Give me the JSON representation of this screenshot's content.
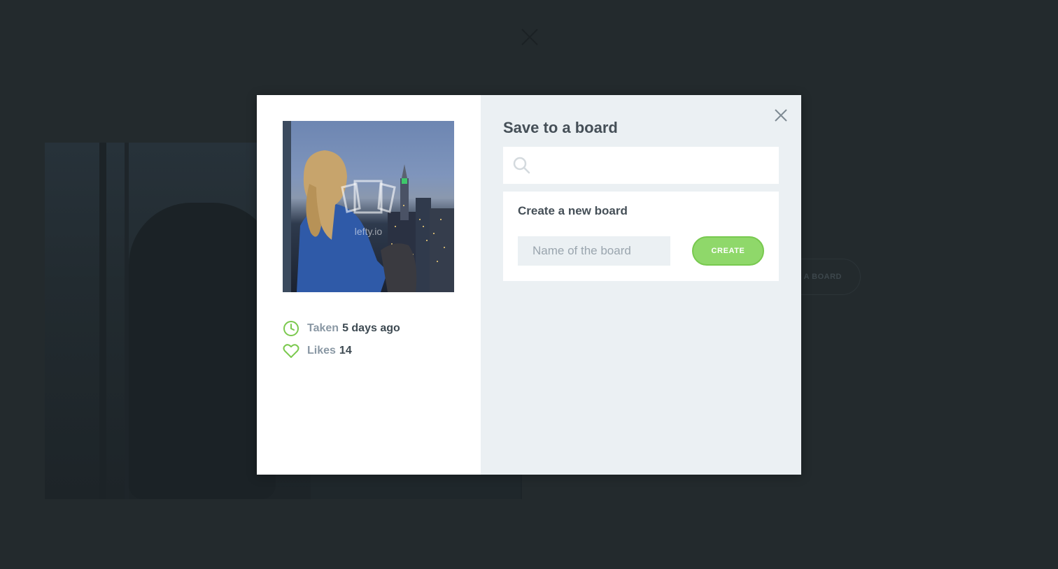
{
  "background": {
    "save_board_label": "A BOARD"
  },
  "modal": {
    "photo": {
      "watermark": "lefty.io"
    },
    "meta": {
      "taken_label": "Taken",
      "taken_value": "5 days ago",
      "likes_label": "Likes",
      "likes_value": "14"
    },
    "title": "Save to a board",
    "search": {
      "placeholder": "",
      "value": ""
    },
    "create_panel": {
      "title": "Create a new board",
      "name_placeholder": "Name of the board",
      "create_label": "CREATE"
    }
  },
  "colors": {
    "accent_green": "#8fd86a",
    "icon_green": "#7bc94e",
    "backdrop": "#232a2d",
    "panel_grey": "#ebf0f3"
  }
}
